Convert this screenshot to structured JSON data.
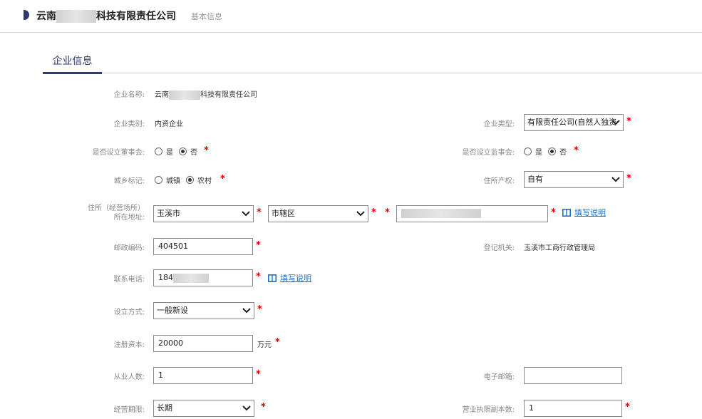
{
  "header": {
    "company_name": "云南▒▒▒▒▒科技有限责任公司",
    "company_prefix": "云南",
    "company_suffix": "科技有限责任公司",
    "subtitle": "基本信息"
  },
  "section": {
    "title": "企业信息"
  },
  "form": {
    "enterprise_name": {
      "label": "企业名称:",
      "prefix": "云南",
      "suffix": "科技有限责任公司"
    },
    "enterprise_category": {
      "label": "企业类别:",
      "value": "内资企业"
    },
    "enterprise_type": {
      "label": "企业类型:",
      "value": "有限责任公司(自然人独资"
    },
    "board_of_directors": {
      "label": "是否设立董事会:",
      "options": [
        "是",
        "否"
      ],
      "selected": "否"
    },
    "board_of_supervisors": {
      "label": "是否设立监事会:",
      "options": [
        "是",
        "否"
      ],
      "selected": "否"
    },
    "urban_rural": {
      "label": "城乡标记:",
      "options": [
        "城镇",
        "农村"
      ],
      "selected": "农村"
    },
    "property_right": {
      "label": "住所产权:",
      "value": "自有"
    },
    "address": {
      "label_line1": "住所（经营场所）",
      "label_line2": "所在地址:",
      "city": "玉溪市",
      "district": "市辖区",
      "detail": ""
    },
    "postal_code": {
      "label": "邮政编码:",
      "value": "404501"
    },
    "registration_authority": {
      "label": "登记机关:",
      "value": "玉溪市工商行政管理局"
    },
    "phone": {
      "label": "联系电话:",
      "value": "184"
    },
    "establish_method": {
      "label": "设立方式:",
      "value": "一般新设"
    },
    "registered_capital": {
      "label": "注册资本:",
      "value": "20000",
      "unit": "万元"
    },
    "employees": {
      "label": "从业人数:",
      "value": "1"
    },
    "email": {
      "label": "电子邮箱:",
      "value": ""
    },
    "operating_period": {
      "label": "经营期限:",
      "value": "长期"
    },
    "license_copies": {
      "label": "营业执照副本数:",
      "value": "1"
    }
  },
  "help_text": "填写说明",
  "required_mark": "*",
  "colors": {
    "accent": "#2f3b6f",
    "required": "#e20000",
    "link": "#1a73c8"
  },
  "icons": [
    "select-arrow-icon",
    "book-icon"
  ]
}
